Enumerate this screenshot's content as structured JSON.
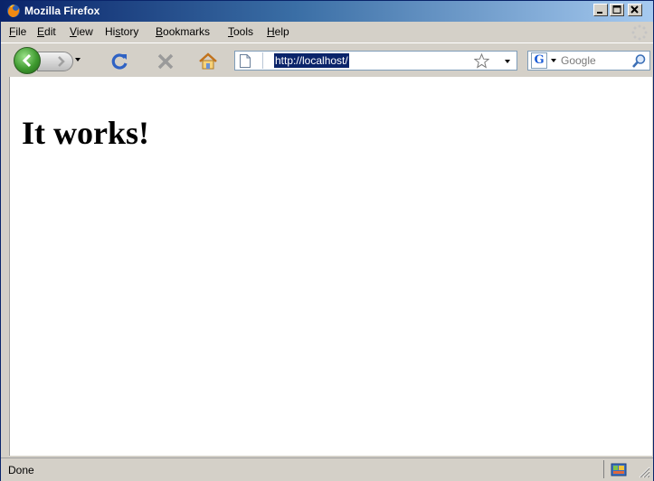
{
  "window": {
    "title": "Mozilla Firefox",
    "controls": {
      "minimize": "_",
      "maximize": "□",
      "close": "X"
    }
  },
  "menu": {
    "items": [
      {
        "pre": "",
        "ul": "F",
        "post": "ile"
      },
      {
        "pre": "",
        "ul": "E",
        "post": "dit"
      },
      {
        "pre": "",
        "ul": "V",
        "post": "iew"
      },
      {
        "pre": "Hi",
        "ul": "s",
        "post": "tory"
      },
      {
        "pre": "",
        "ul": "B",
        "post": "ookmarks"
      },
      {
        "pre": "",
        "ul": "T",
        "post": "ools"
      },
      {
        "pre": "",
        "ul": "H",
        "post": "elp"
      }
    ]
  },
  "navigation": {
    "url": "http://localhost/",
    "search_placeholder": "Google",
    "search_engine_letter": "G"
  },
  "content": {
    "heading": "It works!"
  },
  "status": {
    "text": "Done"
  },
  "colors": {
    "titlebar_start": "#0a246a",
    "titlebar_end": "#a6caf0",
    "chrome": "#d4d0c8",
    "selection": "#0a246a"
  }
}
